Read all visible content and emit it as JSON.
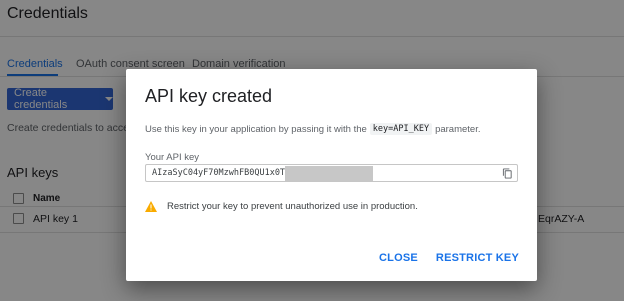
{
  "page": {
    "title": "Credentials",
    "tabs": [
      {
        "label": "Credentials",
        "active": true
      },
      {
        "label": "OAuth consent screen",
        "active": false
      },
      {
        "label": "Domain verification",
        "active": false
      }
    ],
    "create_button": "Create credentials",
    "create_description": "Create credentials to acce",
    "section_title": "API keys",
    "table": {
      "header_name": "Name",
      "rows": [
        {
          "name": "API key 1",
          "key_tail": "EqrAZY-A"
        }
      ]
    }
  },
  "dialog": {
    "title": "API key created",
    "description_prefix": "Use this key in your application by passing it with the",
    "description_code": "key=API_KEY",
    "description_suffix": "parameter.",
    "field_label": "Your API key",
    "api_key_value": "AIzaSyC04yF70MzwhFB0QU1x0T",
    "warning_text": "Restrict your key to prevent unauthorized use in production.",
    "close_label": "CLOSE",
    "restrict_label": "RESTRICT KEY"
  },
  "colors": {
    "accent": "#1a73e8",
    "button_bg": "#3367d6",
    "warning": "#f9ab00"
  },
  "icons": {
    "copy": "copy-icon",
    "warning": "warning-icon",
    "dropdown": "chevron-down-icon"
  }
}
